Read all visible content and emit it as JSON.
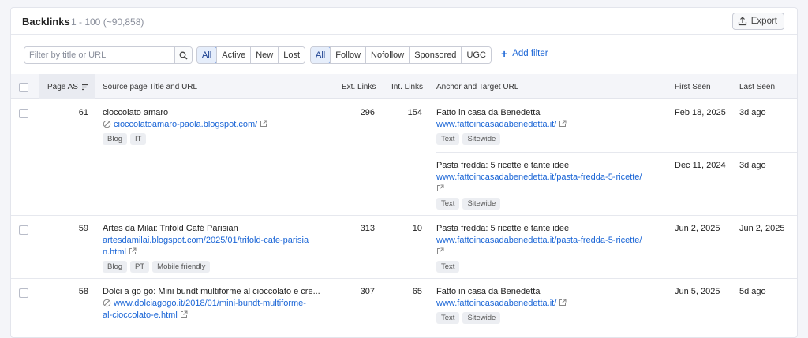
{
  "header": {
    "title": "Backlinks",
    "count": "1 - 100 (~90,858)",
    "export_label": "Export"
  },
  "search": {
    "placeholder": "Filter by title or URL"
  },
  "status_filter": [
    "All",
    "Active",
    "New",
    "Lost"
  ],
  "type_filter": [
    "All",
    "Follow",
    "Nofollow",
    "Sponsored",
    "UGC"
  ],
  "add_filter": "Add filter",
  "columns": {
    "page_as": "Page AS",
    "source": "Source page Title and URL",
    "ext": "Ext. Links",
    "int": "Int. Links",
    "anchor": "Anchor and Target URL",
    "first": "First Seen",
    "last": "Last Seen"
  },
  "rows": [
    {
      "page_as": "61",
      "title": "cioccolato amaro",
      "url": "cioccolatoamaro-paola.blogspot.com/",
      "tags": [
        "Blog",
        "IT"
      ],
      "ext": "296",
      "int": "154",
      "anchors": [
        {
          "anchor": "Fatto in casa da Benedetta",
          "target": "www.fattoincasadabenedetta.it/",
          "tags": [
            "Text",
            "Sitewide"
          ],
          "first": "Feb 18, 2025",
          "last": "3d ago"
        },
        {
          "anchor": "Pasta fredda: 5 ricette e tante idee",
          "target": "www.fattoincasadabenedetta.it/pasta-fredda-5-ricette/",
          "tags": [
            "Text",
            "Sitewide"
          ],
          "first": "Dec 11, 2024",
          "last": "3d ago"
        }
      ]
    },
    {
      "page_as": "59",
      "title": "Artes da Milai: Trifold Café Parisian",
      "url_line1": "artesdamilai.blogspot.com/2025/01/trifold-cafe-parisia",
      "url_line2": "n.html",
      "tags": [
        "Blog",
        "PT",
        "Mobile friendly"
      ],
      "ext": "313",
      "int": "10",
      "anchor": "Pasta fredda: 5 ricette e tante idee",
      "target": "www.fattoincasadabenedetta.it/pasta-fredda-5-ricette/",
      "anchor_tags": [
        "Text"
      ],
      "first": "Jun 2, 2025",
      "last": "Jun 2, 2025"
    },
    {
      "page_as": "58",
      "title": "Dolci a go go: Mini bundt multiforme al cioccolato e cre...",
      "url_line1": "www.dolciagogo.it/2018/01/mini-bundt-multiforme-",
      "url_line2": "al-cioccolato-e.html",
      "ext": "307",
      "int": "65",
      "anchor": "Fatto in casa da Benedetta",
      "target": "www.fattoincasadabenedetta.it/",
      "anchor_tags": [
        "Text",
        "Sitewide"
      ],
      "first": "Jun 5, 2025",
      "last": "5d ago"
    }
  ],
  "colors": {
    "accent": "#1a65d6",
    "active_bg": "#e6eefb"
  }
}
